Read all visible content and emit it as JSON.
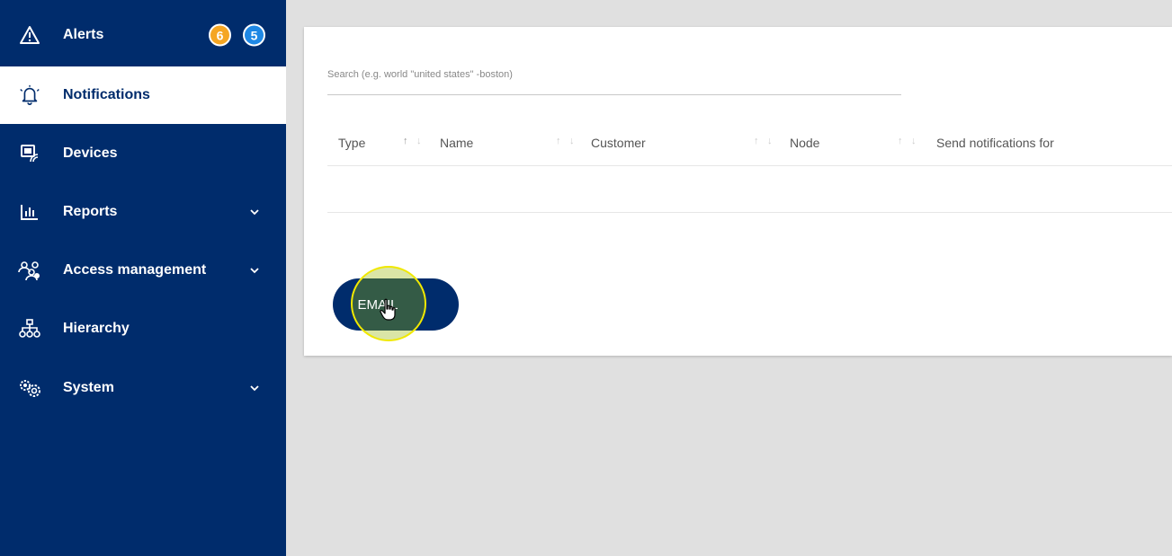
{
  "sidebar": {
    "items": [
      {
        "label": "Alerts",
        "icon": "warning-icon"
      },
      {
        "label": "Notifications",
        "icon": "bell-icon"
      },
      {
        "label": "Devices",
        "icon": "devices-icon"
      },
      {
        "label": "Reports",
        "icon": "bar-chart-icon"
      },
      {
        "label": "Access management",
        "icon": "users-icon"
      },
      {
        "label": "Hierarchy",
        "icon": "hierarchy-icon"
      },
      {
        "label": "System",
        "icon": "gears-icon"
      }
    ],
    "badges": {
      "orange": "6",
      "blue": "5"
    }
  },
  "search": {
    "placeholder": "Search (e.g. world \"united states\" -boston)"
  },
  "table": {
    "columns": [
      "Type",
      "Name",
      "Customer",
      "Node",
      "Send notifications for"
    ]
  },
  "actions": {
    "email_label": "EMAIL"
  },
  "colors": {
    "brand": "#002c6c",
    "badge_orange": "#f5a623",
    "badge_blue": "#1e88e5",
    "highlight": "#f0e800"
  }
}
